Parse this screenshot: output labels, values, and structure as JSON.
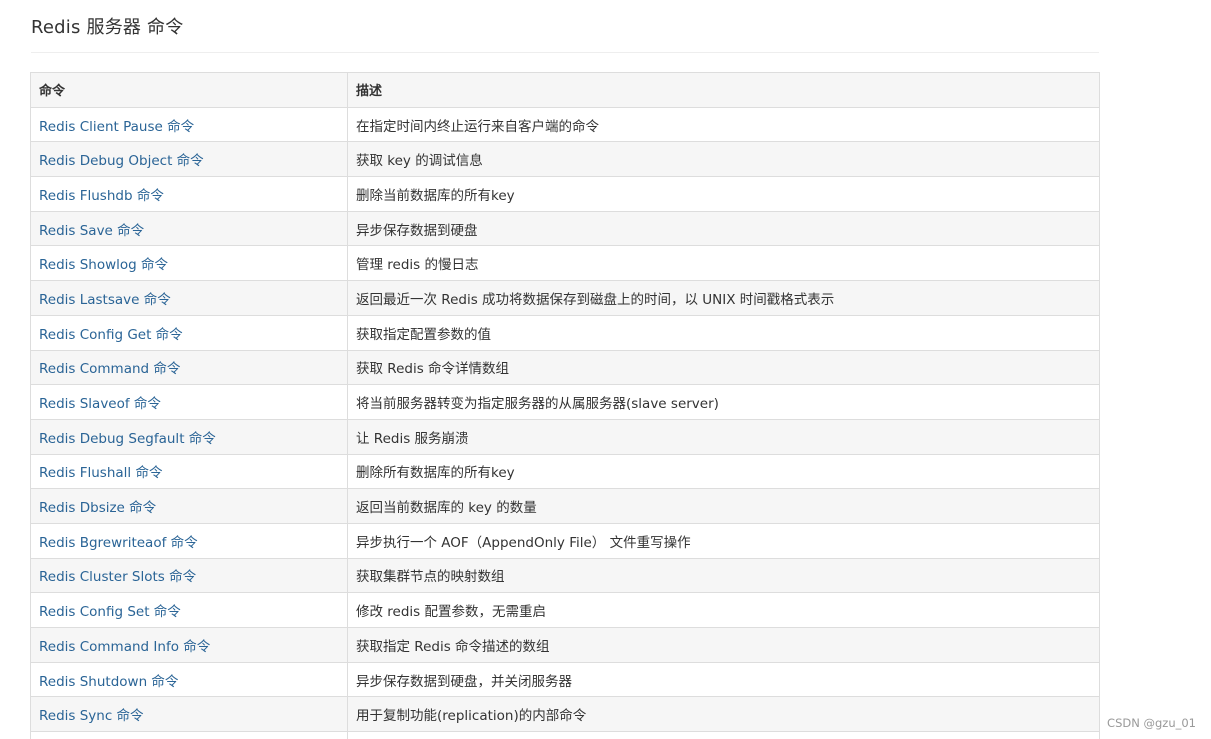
{
  "page": {
    "title": "Redis 服务器 命令"
  },
  "table": {
    "headers": [
      "命令",
      "描述"
    ],
    "rows": [
      {
        "command": "Redis Client Pause 命令",
        "description": "在指定时间内终止运行来自客户端的命令"
      },
      {
        "command": "Redis Debug Object 命令",
        "description": "获取 key 的调试信息"
      },
      {
        "command": "Redis Flushdb 命令",
        "description": "删除当前数据库的所有key"
      },
      {
        "command": "Redis Save 命令",
        "description": "异步保存数据到硬盘"
      },
      {
        "command": "Redis Showlog 命令",
        "description": "管理 redis 的慢日志"
      },
      {
        "command": "Redis Lastsave 命令",
        "description": "返回最近一次 Redis 成功将数据保存到磁盘上的时间，以 UNIX 时间戳格式表示"
      },
      {
        "command": "Redis Config Get 命令",
        "description": "获取指定配置参数的值"
      },
      {
        "command": "Redis Command 命令",
        "description": "获取 Redis 命令详情数组"
      },
      {
        "command": "Redis Slaveof 命令",
        "description": "将当前服务器转变为指定服务器的从属服务器(slave server)"
      },
      {
        "command": "Redis Debug Segfault 命令",
        "description": "让 Redis 服务崩溃"
      },
      {
        "command": "Redis Flushall 命令",
        "description": "删除所有数据库的所有key"
      },
      {
        "command": "Redis Dbsize 命令",
        "description": "返回当前数据库的 key 的数量"
      },
      {
        "command": "Redis Bgrewriteaof 命令",
        "description": "异步执行一个 AOF（AppendOnly File） 文件重写操作"
      },
      {
        "command": "Redis Cluster Slots 命令",
        "description": "获取集群节点的映射数组"
      },
      {
        "command": "Redis Config Set 命令",
        "description": "修改 redis 配置参数，无需重启"
      },
      {
        "command": "Redis Command Info 命令",
        "description": "获取指定 Redis 命令描述的数组"
      },
      {
        "command": "Redis Shutdown 命令",
        "description": "异步保存数据到硬盘，并关闭服务器"
      },
      {
        "command": "Redis Sync 命令",
        "description": "用于复制功能(replication)的内部命令"
      },
      {
        "command": "",
        "description": ""
      }
    ]
  },
  "watermark": "CSDN @gzu_01",
  "colors": {
    "link": "#2a6496",
    "stripe": "#f6f6f6",
    "border": "#dddddd",
    "text": "#333333"
  }
}
